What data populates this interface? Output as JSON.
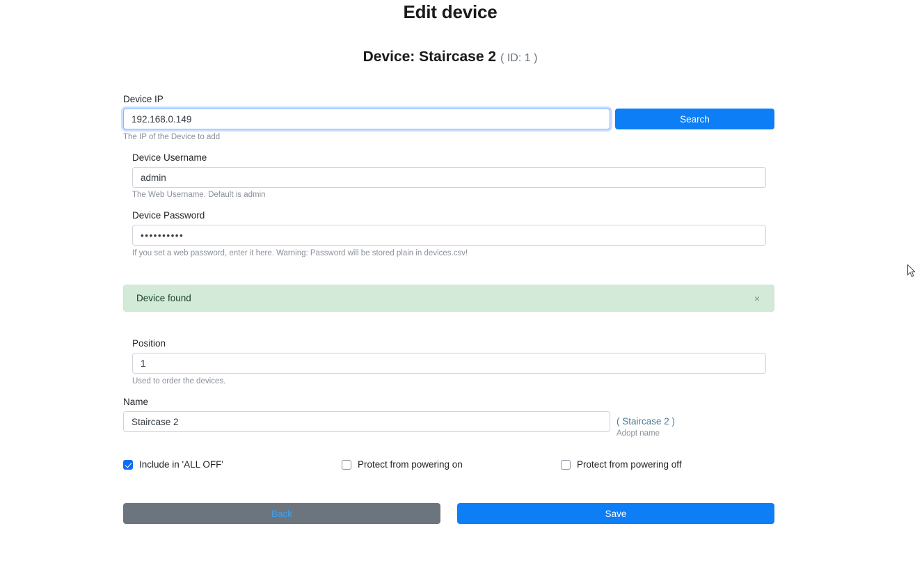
{
  "header": {
    "page_title": "Edit device",
    "device_title": "Device: Staircase 2",
    "device_id_text": "( ID: 1 )"
  },
  "form": {
    "device_ip": {
      "label": "Device IP",
      "value": "192.168.0.149",
      "placeholder": "Device IP",
      "help": "The IP of the Device to add"
    },
    "search_button": "Search",
    "device_username": {
      "label": "Device Username",
      "value": "admin",
      "placeholder": "Device Username",
      "help": "The Web Username. Default is admin"
    },
    "device_password": {
      "label": "Device Password",
      "value": "••••••••••",
      "placeholder": "Device Password",
      "help": "If you set a web password, enter it here. Warning: Password will be stored plain in devices.csv!"
    },
    "position": {
      "label": "Position",
      "value": "1",
      "placeholder": "Position",
      "help": "Used to order the devices."
    },
    "name": {
      "label": "Name",
      "value": "Staircase 2",
      "placeholder": "Name",
      "adopt_link": "( Staircase 2 )",
      "adopt_sub": "Adopt name"
    }
  },
  "alert": {
    "message": "Device found",
    "close_icon": "×",
    "background_color": "#d3ead8",
    "text_color": "#17412a"
  },
  "checkboxes": [
    {
      "label": "Include in 'ALL OFF'",
      "checked": true
    },
    {
      "label": "Protect from powering on",
      "checked": false
    },
    {
      "label": "Protect from powering off",
      "checked": false
    }
  ],
  "footer": {
    "back_button": "Back",
    "save_button": "Save"
  },
  "colors": {
    "primary": "#0d7ef5",
    "secondary": "#6c757d",
    "success_bg": "#d3ead8",
    "link": "#4b7b96",
    "checkbox_checked": "#0d6efd"
  }
}
